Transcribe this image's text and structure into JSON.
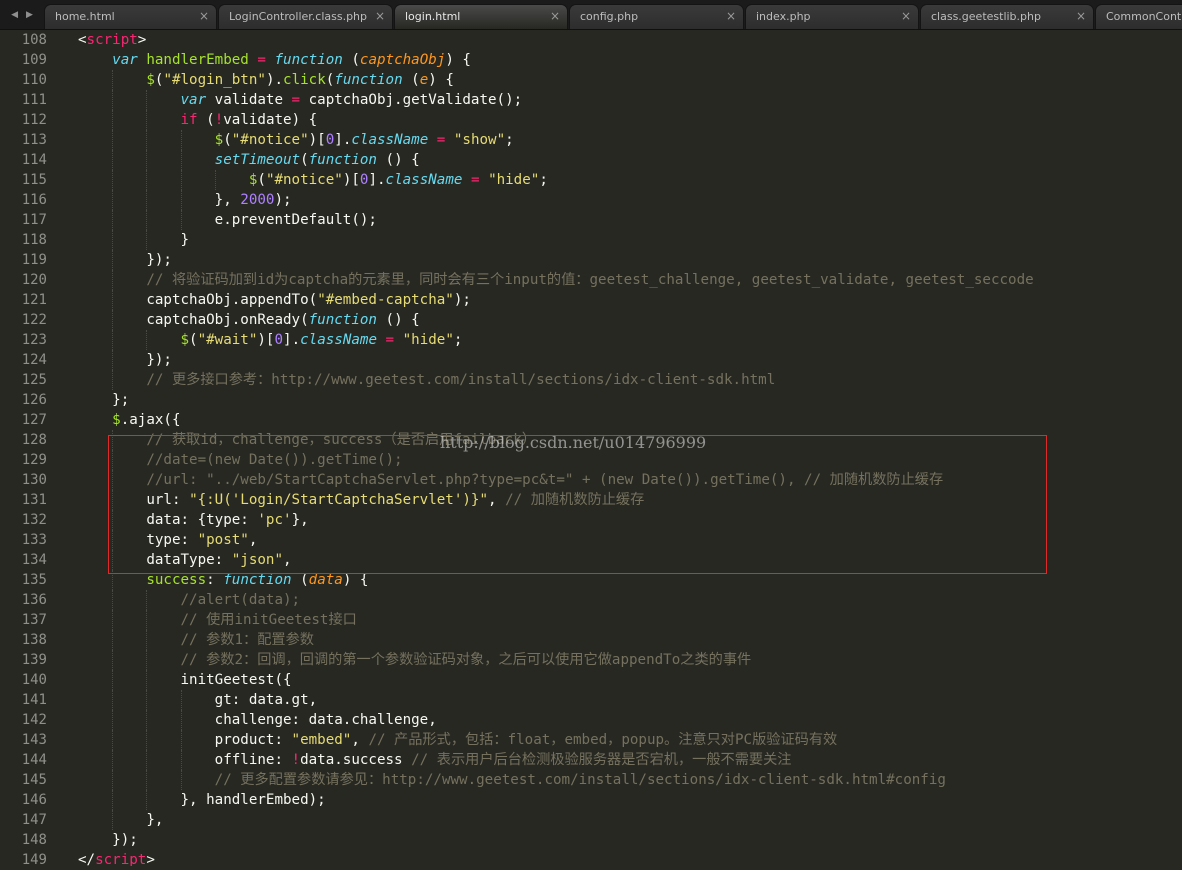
{
  "nav_arrows": [
    "◀",
    "▶"
  ],
  "tabs": [
    {
      "label": "home.html",
      "active": false
    },
    {
      "label": "LoginController.class.php",
      "active": false
    },
    {
      "label": "login.html",
      "active": true
    },
    {
      "label": "config.php",
      "active": false
    },
    {
      "label": "index.php",
      "active": false
    },
    {
      "label": "class.geetestlib.php",
      "active": false
    },
    {
      "label": "CommonContro",
      "active": false
    }
  ],
  "close_glyph": "×",
  "watermark": "http://blog.csdn.net/u014796999",
  "colors": {
    "background": "#272822",
    "keyword": "#66d9ef",
    "function": "#a6e22e",
    "string": "#e6db74",
    "number": "#ae81ff",
    "operator": "#f92672",
    "parameter": "#fd971f",
    "comment": "#75715e",
    "highlight_box": "#e02a2a"
  },
  "code_lines": [
    {
      "n": "108",
      "indent": 0,
      "tokens": [
        [
          "p",
          "<"
        ],
        [
          "tag",
          "script"
        ],
        [
          "p",
          ">"
        ]
      ]
    },
    {
      "n": "109",
      "indent": 1,
      "tokens": [
        [
          "kw",
          "var"
        ],
        [
          "p",
          " "
        ],
        [
          "fn",
          "handlerEmbed"
        ],
        [
          "p",
          " "
        ],
        [
          "op",
          "="
        ],
        [
          "p",
          " "
        ],
        [
          "kw",
          "function"
        ],
        [
          "p",
          " ("
        ],
        [
          "prm",
          "captchaObj"
        ],
        [
          "p",
          ") {"
        ]
      ]
    },
    {
      "n": "110",
      "indent": 2,
      "tokens": [
        [
          "fn",
          "$"
        ],
        [
          "p",
          "("
        ],
        [
          "str",
          "\"#login_btn\""
        ],
        [
          "p",
          ")."
        ],
        [
          "fn",
          "click"
        ],
        [
          "p",
          "("
        ],
        [
          "kw",
          "function"
        ],
        [
          "p",
          " ("
        ],
        [
          "prm",
          "e"
        ],
        [
          "p",
          ") {"
        ]
      ]
    },
    {
      "n": "111",
      "indent": 3,
      "tokens": [
        [
          "kw",
          "var"
        ],
        [
          "p",
          " validate "
        ],
        [
          "op",
          "="
        ],
        [
          "p",
          " captchaObj.getValidate();"
        ]
      ]
    },
    {
      "n": "112",
      "indent": 3,
      "tokens": [
        [
          "op",
          "if"
        ],
        [
          "p",
          " ("
        ],
        [
          "op",
          "!"
        ],
        [
          "p",
          "validate) {"
        ]
      ]
    },
    {
      "n": "113",
      "indent": 4,
      "tokens": [
        [
          "fn",
          "$"
        ],
        [
          "p",
          "("
        ],
        [
          "str",
          "\"#notice\""
        ],
        [
          "p",
          ")["
        ],
        [
          "num",
          "0"
        ],
        [
          "p",
          "]."
        ],
        [
          "kw2",
          "className"
        ],
        [
          "p",
          " "
        ],
        [
          "op",
          "="
        ],
        [
          "p",
          " "
        ],
        [
          "str",
          "\"show\""
        ],
        [
          "p",
          ";"
        ]
      ]
    },
    {
      "n": "114",
      "indent": 4,
      "tokens": [
        [
          "kw2",
          "setTimeout"
        ],
        [
          "p",
          "("
        ],
        [
          "kw",
          "function"
        ],
        [
          "p",
          " () {"
        ]
      ]
    },
    {
      "n": "115",
      "indent": 5,
      "tokens": [
        [
          "fn",
          "$"
        ],
        [
          "p",
          "("
        ],
        [
          "str",
          "\"#notice\""
        ],
        [
          "p",
          ")["
        ],
        [
          "num",
          "0"
        ],
        [
          "p",
          "]."
        ],
        [
          "kw2",
          "className"
        ],
        [
          "p",
          " "
        ],
        [
          "op",
          "="
        ],
        [
          "p",
          " "
        ],
        [
          "str",
          "\"hide\""
        ],
        [
          "p",
          ";"
        ]
      ]
    },
    {
      "n": "116",
      "indent": 4,
      "tokens": [
        [
          "p",
          "}, "
        ],
        [
          "num",
          "2000"
        ],
        [
          "p",
          ");"
        ]
      ]
    },
    {
      "n": "117",
      "indent": 4,
      "tokens": [
        [
          "p",
          "e.preventDefault();"
        ]
      ]
    },
    {
      "n": "118",
      "indent": 3,
      "tokens": [
        [
          "p",
          "}"
        ]
      ]
    },
    {
      "n": "119",
      "indent": 2,
      "tokens": [
        [
          "p",
          "});"
        ]
      ]
    },
    {
      "n": "120",
      "indent": 2,
      "tokens": [
        [
          "cmt",
          "// 将验证码加到id为captcha的元素里，同时会有三个input的值：geetest_challenge, geetest_validate, geetest_seccode"
        ]
      ]
    },
    {
      "n": "121",
      "indent": 2,
      "tokens": [
        [
          "p",
          "captchaObj.appendTo("
        ],
        [
          "str",
          "\"#embed-captcha\""
        ],
        [
          "p",
          ");"
        ]
      ]
    },
    {
      "n": "122",
      "indent": 2,
      "tokens": [
        [
          "p",
          "captchaObj.onReady("
        ],
        [
          "kw",
          "function"
        ],
        [
          "p",
          " () {"
        ]
      ]
    },
    {
      "n": "123",
      "indent": 3,
      "tokens": [
        [
          "fn",
          "$"
        ],
        [
          "p",
          "("
        ],
        [
          "str",
          "\"#wait\""
        ],
        [
          "p",
          ")["
        ],
        [
          "num",
          "0"
        ],
        [
          "p",
          "]."
        ],
        [
          "kw2",
          "className"
        ],
        [
          "p",
          " "
        ],
        [
          "op",
          "="
        ],
        [
          "p",
          " "
        ],
        [
          "str",
          "\"hide\""
        ],
        [
          "p",
          ";"
        ]
      ]
    },
    {
      "n": "124",
      "indent": 2,
      "tokens": [
        [
          "p",
          "});"
        ]
      ]
    },
    {
      "n": "125",
      "indent": 2,
      "tokens": [
        [
          "cmt",
          "// 更多接口参考：http://www.geetest.com/install/sections/idx-client-sdk.html"
        ]
      ]
    },
    {
      "n": "126",
      "indent": 1,
      "tokens": [
        [
          "p",
          "};"
        ]
      ]
    },
    {
      "n": "127",
      "indent": 1,
      "tokens": [
        [
          "fn",
          "$"
        ],
        [
          "p",
          ".ajax({"
        ]
      ]
    },
    {
      "n": "128",
      "indent": 2,
      "tokens": [
        [
          "cmt",
          "// 获取id，challenge，success（是否启用failback）"
        ]
      ]
    },
    {
      "n": "129",
      "indent": 2,
      "tokens": [
        [
          "cmt",
          "//date=(new Date()).getTime();"
        ]
      ]
    },
    {
      "n": "130",
      "indent": 2,
      "tokens": [
        [
          "cmt",
          "//url: \"../web/StartCaptchaServlet.php?type=pc&t=\" + (new Date()).getTime(), // 加随机数防止缓存"
        ]
      ]
    },
    {
      "n": "131",
      "indent": 2,
      "tokens": [
        [
          "p",
          "url: "
        ],
        [
          "str",
          "\"{:U('Login/StartCaptchaServlet')}\""
        ],
        [
          "p",
          ", "
        ],
        [
          "cmt",
          "// 加随机数防止缓存"
        ]
      ]
    },
    {
      "n": "132",
      "indent": 2,
      "tokens": [
        [
          "p",
          "data: {type: "
        ],
        [
          "str",
          "'pc'"
        ],
        [
          "p",
          "},"
        ]
      ]
    },
    {
      "n": "133",
      "indent": 2,
      "tokens": [
        [
          "p",
          "type: "
        ],
        [
          "str",
          "\"post\""
        ],
        [
          "p",
          ","
        ]
      ]
    },
    {
      "n": "134",
      "indent": 2,
      "tokens": [
        [
          "p",
          "dataType: "
        ],
        [
          "str",
          "\"json\""
        ],
        [
          "p",
          ","
        ]
      ]
    },
    {
      "n": "135",
      "indent": 2,
      "tokens": [
        [
          "fn",
          "success"
        ],
        [
          "p",
          ": "
        ],
        [
          "kw",
          "function"
        ],
        [
          "p",
          " ("
        ],
        [
          "prm",
          "data"
        ],
        [
          "p",
          ") {"
        ]
      ]
    },
    {
      "n": "136",
      "indent": 3,
      "tokens": [
        [
          "cmt",
          "//alert(data);"
        ]
      ]
    },
    {
      "n": "137",
      "indent": 3,
      "tokens": [
        [
          "cmt",
          "// 使用initGeetest接口"
        ]
      ]
    },
    {
      "n": "138",
      "indent": 3,
      "tokens": [
        [
          "cmt",
          "// 参数1：配置参数"
        ]
      ]
    },
    {
      "n": "139",
      "indent": 3,
      "tokens": [
        [
          "cmt",
          "// 参数2：回调，回调的第一个参数验证码对象，之后可以使用它做appendTo之类的事件"
        ]
      ]
    },
    {
      "n": "140",
      "indent": 3,
      "tokens": [
        [
          "p",
          "initGeetest({"
        ]
      ]
    },
    {
      "n": "141",
      "indent": 4,
      "tokens": [
        [
          "p",
          "gt: data.gt,"
        ]
      ]
    },
    {
      "n": "142",
      "indent": 4,
      "tokens": [
        [
          "p",
          "challenge: data.challenge,"
        ]
      ]
    },
    {
      "n": "143",
      "indent": 4,
      "tokens": [
        [
          "p",
          "product: "
        ],
        [
          "str",
          "\"embed\""
        ],
        [
          "p",
          ", "
        ],
        [
          "cmt",
          "// 产品形式，包括：float，embed，popup。注意只对PC版验证码有效"
        ]
      ]
    },
    {
      "n": "144",
      "indent": 4,
      "tokens": [
        [
          "p",
          "offline: "
        ],
        [
          "op",
          "!"
        ],
        [
          "p",
          "data.success "
        ],
        [
          "cmt",
          "// 表示用户后台检测极验服务器是否宕机，一般不需要关注"
        ]
      ]
    },
    {
      "n": "145",
      "indent": 4,
      "tokens": [
        [
          "cmt",
          "// 更多配置参数请参见：http://www.geetest.com/install/sections/idx-client-sdk.html#config"
        ]
      ]
    },
    {
      "n": "146",
      "indent": 3,
      "tokens": [
        [
          "p",
          "}, handlerEmbed);"
        ]
      ]
    },
    {
      "n": "147",
      "indent": 2,
      "tokens": [
        [
          "p",
          "},"
        ]
      ]
    },
    {
      "n": "148",
      "indent": 1,
      "tokens": [
        [
          "p",
          "});"
        ]
      ]
    },
    {
      "n": "149",
      "indent": 0,
      "tokens": [
        [
          "p",
          "</"
        ],
        [
          "tag",
          "script"
        ],
        [
          "p",
          ">"
        ]
      ]
    }
  ]
}
